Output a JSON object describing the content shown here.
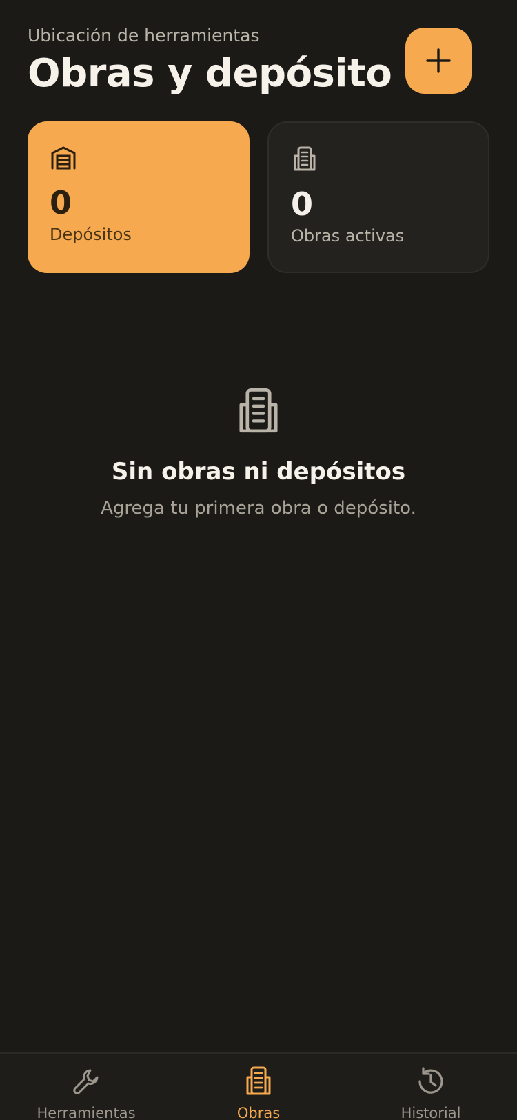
{
  "header": {
    "subtitle": "Ubicación de herramientas",
    "title": "Obras y depósito"
  },
  "stats": [
    {
      "count": "0",
      "label": "Depósitos",
      "icon": "warehouse-icon"
    },
    {
      "count": "0",
      "label": "Obras activas",
      "icon": "building-icon"
    }
  ],
  "empty_state": {
    "icon": "building-icon",
    "title": "Sin obras ni depósitos",
    "subtitle": "Agrega tu primera obra o depósito."
  },
  "nav": [
    {
      "label": "Herramientas",
      "icon": "wrench-icon",
      "active": false
    },
    {
      "label": "Obras",
      "icon": "building-icon",
      "active": true
    },
    {
      "label": "Historial",
      "icon": "history-icon",
      "active": false
    }
  ],
  "colors": {
    "background": "#1b1a17",
    "accent": "#f6a94f",
    "card_dark": "#23221e",
    "text_muted": "#b9b3a8"
  }
}
